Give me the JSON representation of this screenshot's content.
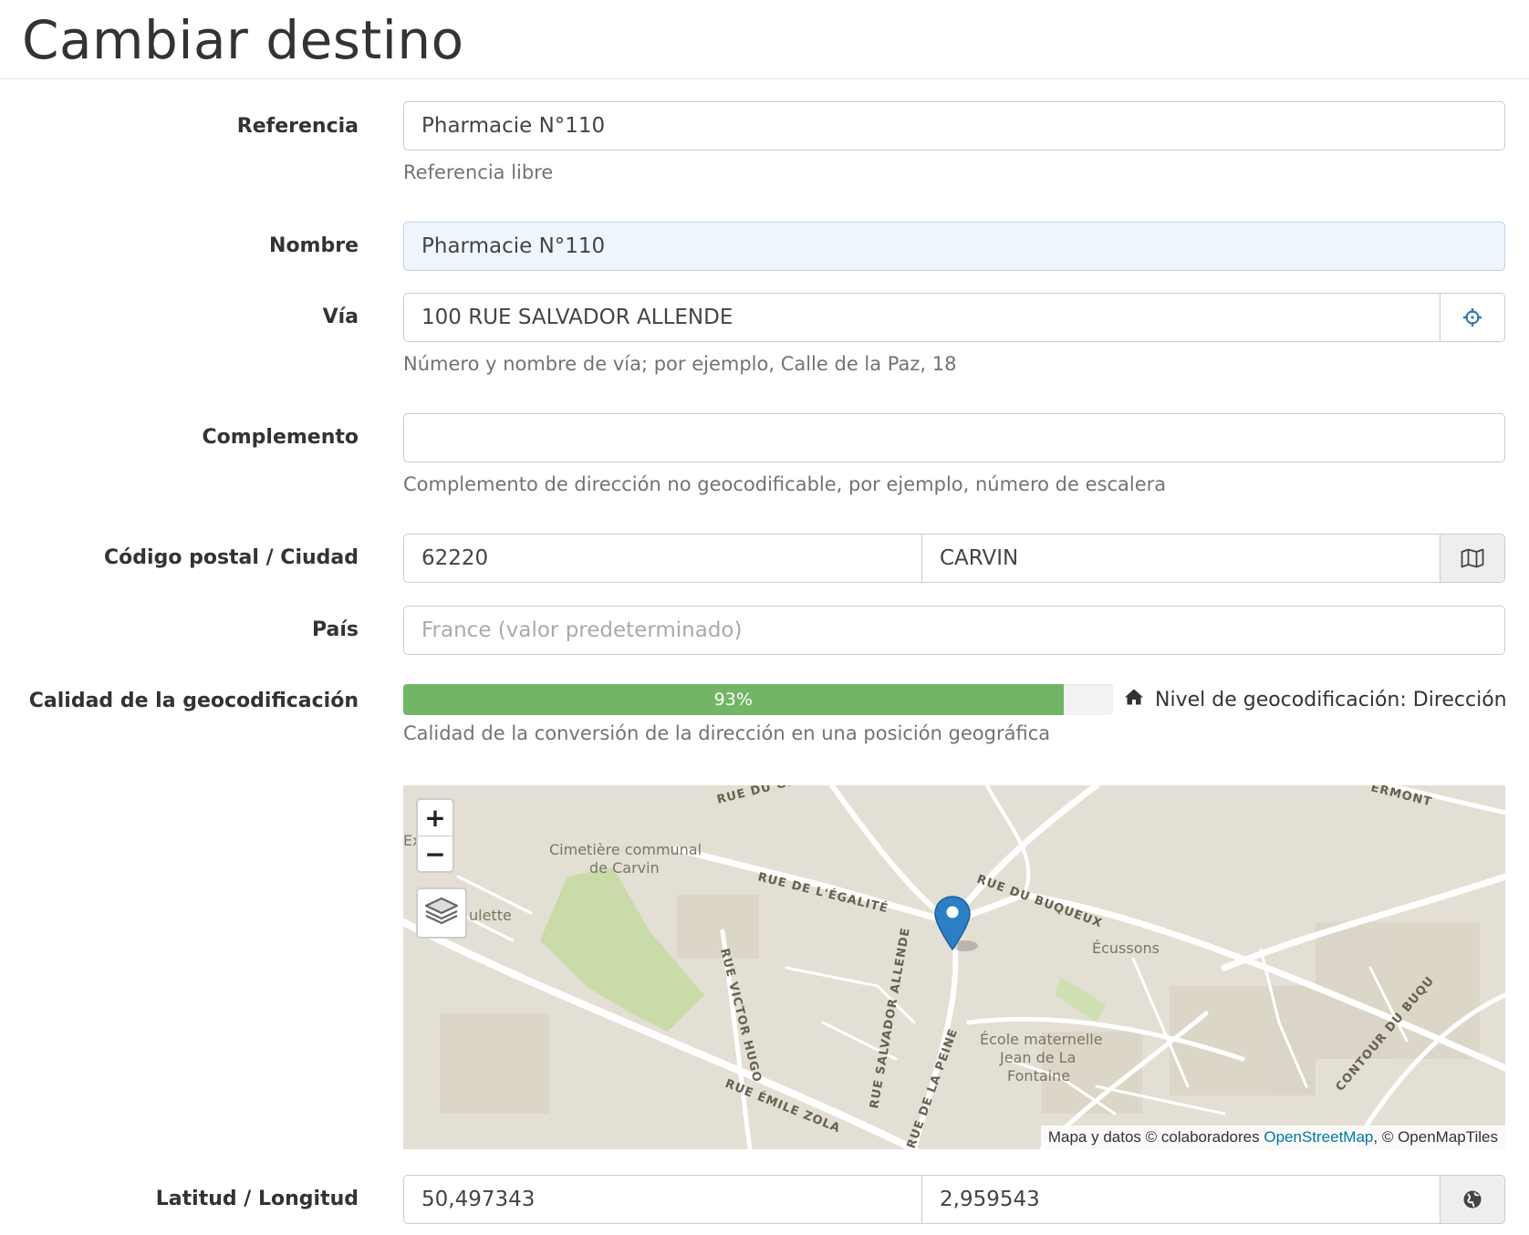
{
  "page": {
    "title": "Cambiar destino"
  },
  "form": {
    "referencia": {
      "label": "Referencia",
      "value": "Pharmacie N°110",
      "help": "Referencia libre"
    },
    "nombre": {
      "label": "Nombre",
      "value": "Pharmacie N°110"
    },
    "via": {
      "label": "Vía",
      "value": "100 RUE SALVADOR ALLENDE",
      "help": "Número y nombre de vía; por ejemplo, Calle de la Paz, 18",
      "icon": "crosshair-icon"
    },
    "complemento": {
      "label": "Complemento",
      "value": "",
      "help": "Complemento de dirección no geocodificable, por ejemplo, número de escalera"
    },
    "postal_ciudad": {
      "label": "Código postal / Ciudad",
      "postal": "62220",
      "city": "CARVIN",
      "icon": "map-icon"
    },
    "pais": {
      "label": "País",
      "placeholder": "France (valor predeterminado)"
    },
    "geocoding": {
      "label": "Calidad de la geocodificación",
      "percent": 93,
      "percent_label": "93%",
      "level_text": "Nivel de geocodificación: Dirección",
      "level_icon": "home-icon",
      "help": "Calidad de la conversión de la dirección en una posición geográfica",
      "bar_color": "#72b565"
    },
    "latlng": {
      "label": "Latitud / Longitud",
      "lat": "50,497343",
      "lng": "2,959543",
      "icon": "globe-icon"
    }
  },
  "map": {
    "zoom_in": "+",
    "zoom_out": "−",
    "labels": {
      "cemetery_1": "Cimetière communal",
      "cemetery_2": "de Carvin",
      "rue_egalite": "RUE DE L'ÉGALITÉ",
      "rue_buqueux": "RUE DU BUQUEUX",
      "ecussons": "Écussons",
      "rue_victor_hugo": "RUE VICTOR HUGO",
      "rue_salvador_allende": "RUE SALVADOR ALLENDE",
      "rue_la_peine": "RUE DE LA PEINE",
      "rue_emile_zola": "RUE ÉMILE ZOLA",
      "ecole_1": "École maternelle",
      "ecole_2": "Jean de La",
      "ecole_3": "Fontaine",
      "contour": "CONTOUR DU BUQU",
      "rue_du_gib": "RUE DU GIB",
      "ermont": "ERMONT",
      "expo": "Expo",
      "culette": "ulette"
    },
    "attribution_prefix": "Mapa y datos © colaboradores ",
    "attribution_link": "OpenStreetMap",
    "attribution_suffix": ", © OpenMapTiles"
  }
}
